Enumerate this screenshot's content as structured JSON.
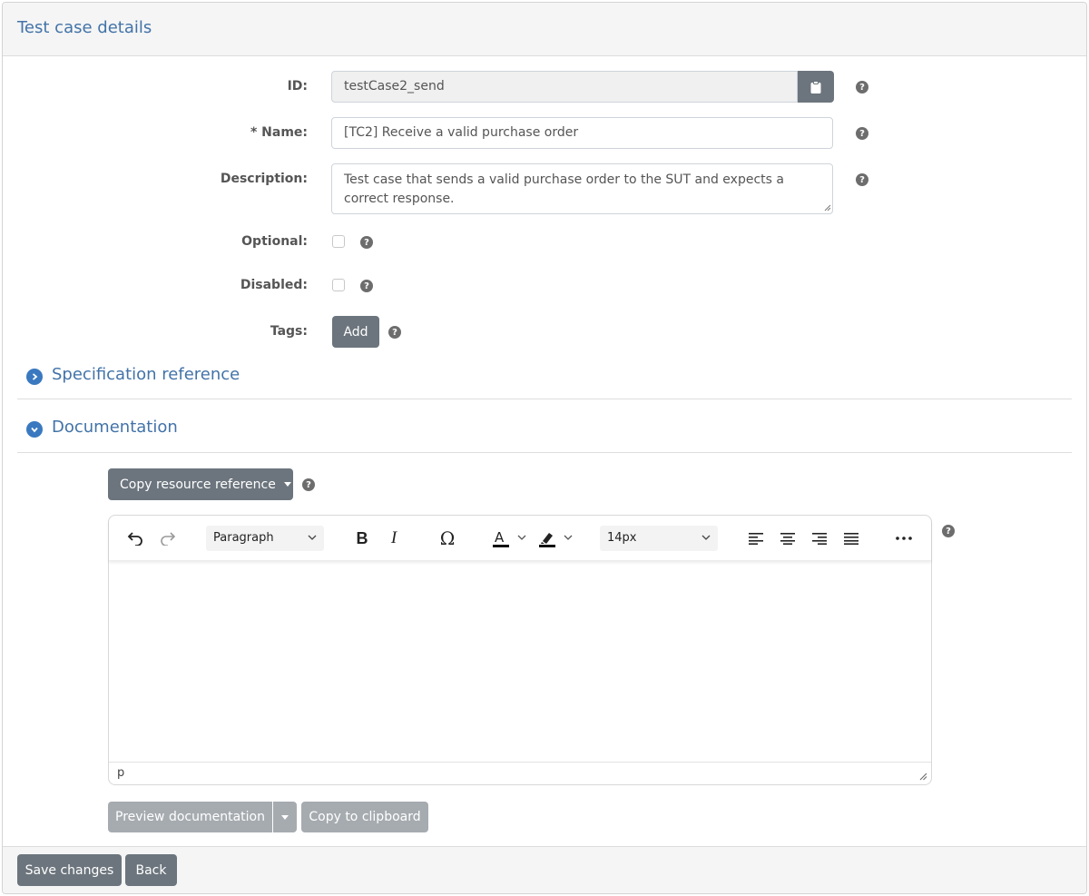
{
  "header": {
    "title": "Test case details"
  },
  "form": {
    "id": {
      "label": "ID:",
      "value": "testCase2_send"
    },
    "name": {
      "label": "* Name:",
      "value": "[TC2] Receive a valid purchase order"
    },
    "description": {
      "label": "Description:",
      "value": "Test case that sends a valid purchase order to the SUT and expects a correct response."
    },
    "optional": {
      "label": "Optional:",
      "checked": false
    },
    "disabled": {
      "label": "Disabled:",
      "checked": false
    },
    "tags": {
      "label": "Tags:",
      "add_label": "Add"
    },
    "help_glyph": "?"
  },
  "sections": {
    "specification": {
      "title": "Specification reference",
      "expanded": false
    },
    "documentation": {
      "title": "Documentation",
      "expanded": true
    }
  },
  "documentation": {
    "copy_resource_label": "Copy resource reference",
    "editor": {
      "block_format": "Paragraph",
      "font_size": "14px",
      "status_path": "p"
    },
    "preview_label": "Preview documentation",
    "copy_clipboard_label": "Copy to clipboard"
  },
  "footer": {
    "save_label": "Save changes",
    "back_label": "Back"
  },
  "colors": {
    "accent": "#4273a8",
    "button": "#6c757d",
    "section_icon": "#3a79c0"
  }
}
